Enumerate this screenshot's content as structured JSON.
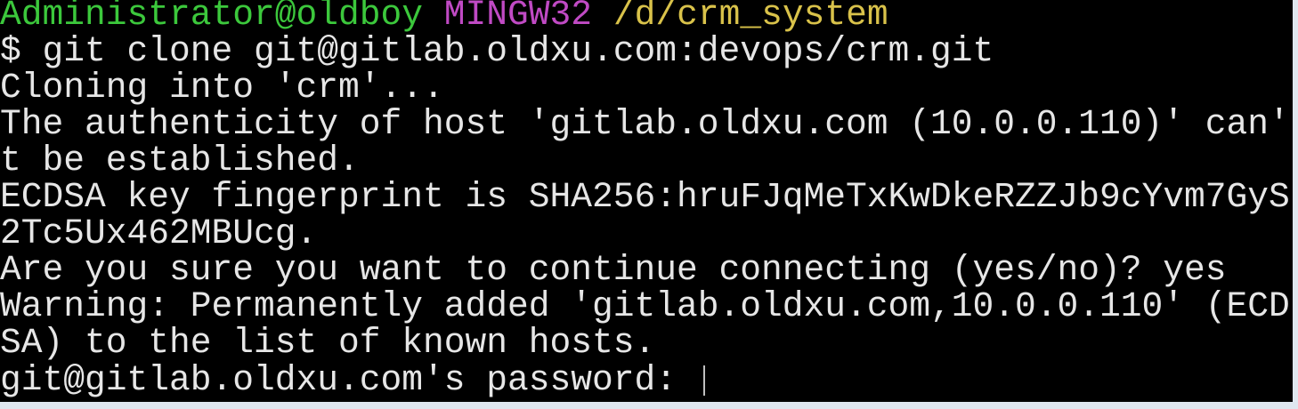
{
  "prompt": {
    "user_host": "Administrator@oldboy",
    "shell": "MINGW32",
    "path": "/d/crm_system",
    "colors": {
      "user_host": "#3cc83c",
      "shell": "#c04ac4",
      "path": "#d9c24a"
    }
  },
  "terminal": {
    "background": "#000000",
    "text_color": "#e6e6e6",
    "lines": [
      "$ git clone git@gitlab.oldxu.com:devops/crm.git",
      "Cloning into 'crm'...",
      "The authenticity of host 'gitlab.oldxu.com (10.0.0.110)' can'",
      "t be established.",
      "ECDSA key fingerprint is SHA256:hruFJqMeTxKwDkeRZZJb9cYvm7GyS",
      "2Tc5Ux462MBUcg.",
      "Are you sure you want to continue connecting (yes/no)? yes",
      "Warning: Permanently added 'gitlab.oldxu.com,10.0.0.110' (ECD",
      "SA) to the list of known hosts.",
      "git@gitlab.oldxu.com's password: "
    ]
  }
}
